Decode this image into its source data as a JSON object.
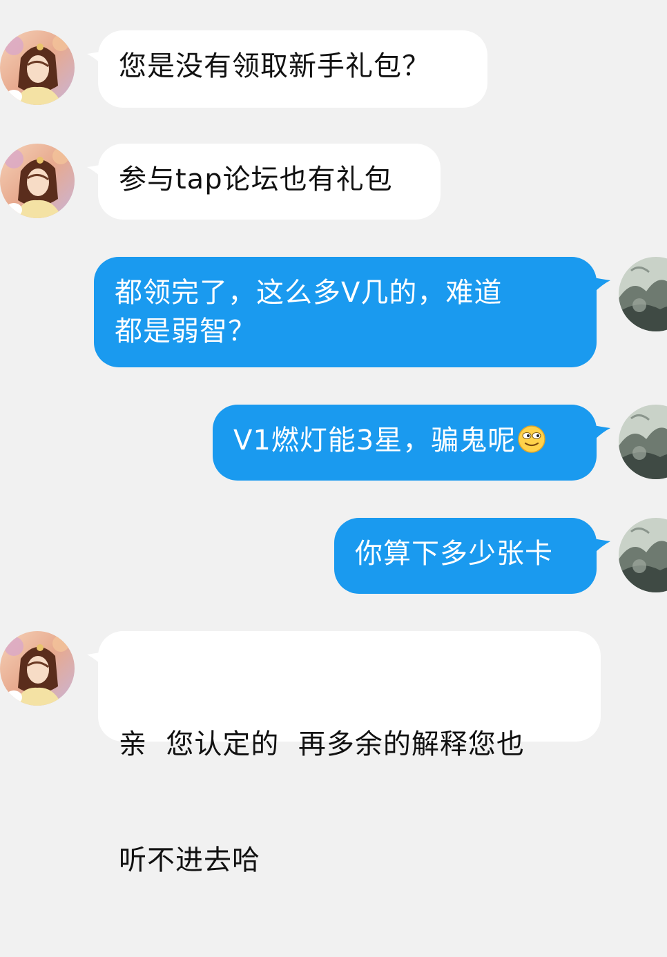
{
  "conversation": {
    "messages": [
      {
        "side": "left",
        "sender": "other",
        "text": "您是没有领取新手礼包？"
      },
      {
        "side": "left",
        "sender": "other",
        "text": "参与tap论坛也有礼包"
      },
      {
        "side": "right",
        "sender": "me",
        "line1": "都领完了，这么多V几的，难道",
        "line2": "都是弱智？"
      },
      {
        "side": "right",
        "sender": "me",
        "text": "V1燃灯能3星，骗鬼呢",
        "emoji": "grinning-face-emoji"
      },
      {
        "side": "right",
        "sender": "me",
        "text": "你算下多少张卡"
      },
      {
        "side": "left",
        "sender": "other",
        "line1": "亲  您认定的  再多余的解释您也",
        "line2": "听不进去哈"
      }
    ]
  },
  "colors": {
    "background": "#f1f1f1",
    "incoming_bubble": "#ffffff",
    "outgoing_bubble": "#1a9aef",
    "incoming_text": "#111111",
    "outgoing_text": "#ffffff"
  },
  "icons": {
    "incoming_avatar": "female-character-avatar",
    "outgoing_avatar": "ink-landscape-avatar"
  }
}
